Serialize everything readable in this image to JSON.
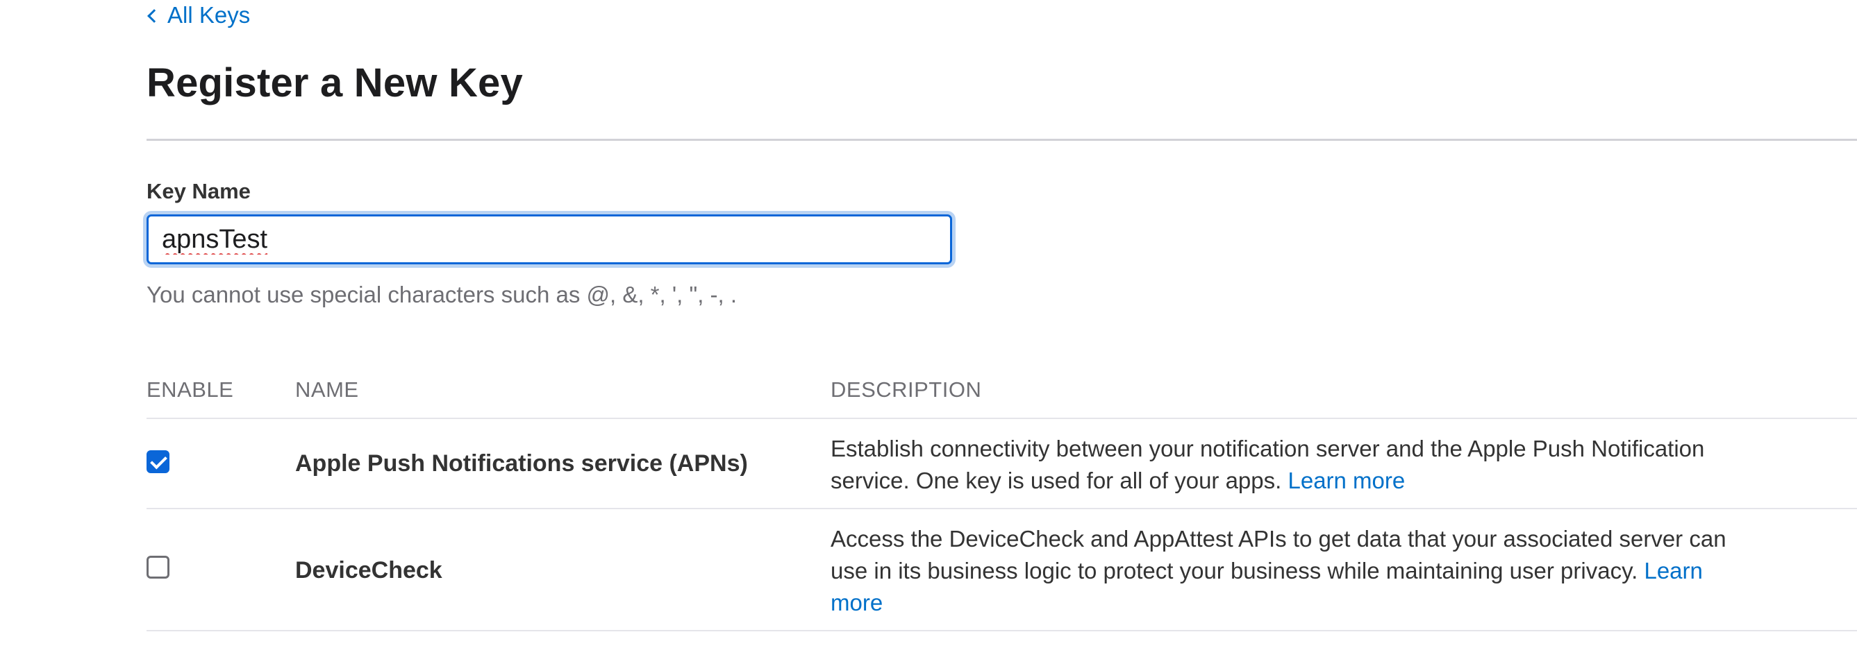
{
  "nav": {
    "back_label": "All Keys"
  },
  "page": {
    "title": "Register a New Key"
  },
  "form": {
    "key_name_label": "Key Name",
    "key_name_value": "apnsTest",
    "key_name_helper": "You cannot use special characters such as @, &, *, ', \", -, ."
  },
  "table": {
    "headers": {
      "enable": "ENABLE",
      "name": "NAME",
      "description": "DESCRIPTION"
    },
    "rows": [
      {
        "enabled": true,
        "name": "Apple Push Notifications service (APNs)",
        "description": "Establish connectivity between your notification server and the Apple Push Notification service. One key is used for all of your apps.",
        "link": "Learn more"
      },
      {
        "enabled": false,
        "name": "DeviceCheck",
        "description": "Access the DeviceCheck and AppAttest APIs to get data that your associated server can use in its business logic to protect your business while maintaining user privacy.",
        "link": "Learn more"
      }
    ]
  },
  "colors": {
    "link": "#0070c9",
    "accent": "#0a66d8",
    "text": "#1d1d1f",
    "muted": "#6e6e73"
  }
}
